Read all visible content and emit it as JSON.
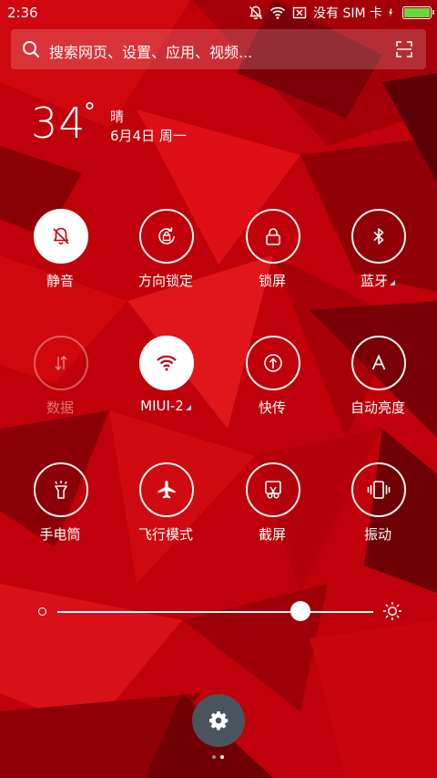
{
  "status_bar": {
    "time": "2:36",
    "carrier": "没有 SIM 卡",
    "icons": [
      "bell-off-icon",
      "wifi-icon",
      "sim-x-icon",
      "charging-icon",
      "battery-icon"
    ],
    "battery_color": "#6bd83a"
  },
  "search": {
    "placeholder": "搜索网页、设置、应用、视频...",
    "icons": [
      "search-icon",
      "scan-icon"
    ]
  },
  "weather": {
    "temperature": "34",
    "degree_symbol": "°",
    "condition": "晴",
    "date": "6月4日 周一"
  },
  "toggles": [
    {
      "label": "静音",
      "state": "on",
      "icon": "bell-off-icon"
    },
    {
      "label": "方向锁定",
      "state": "off",
      "icon": "rotation-lock-icon"
    },
    {
      "label": "锁屏",
      "state": "off",
      "icon": "lock-icon"
    },
    {
      "label": "蓝牙",
      "state": "off",
      "icon": "bluetooth-icon",
      "has_detail": true
    },
    {
      "label": "数据",
      "state": "disabled",
      "icon": "mobile-data-icon"
    },
    {
      "label": "MIUI-2",
      "state": "on",
      "icon": "wifi-icon",
      "has_detail": true
    },
    {
      "label": "快传",
      "state": "off",
      "icon": "quick-transfer-icon"
    },
    {
      "label": "自动亮度",
      "state": "off",
      "icon": "auto-brightness-icon"
    },
    {
      "label": "手电筒",
      "state": "off",
      "icon": "flashlight-icon"
    },
    {
      "label": "飞行模式",
      "state": "off",
      "icon": "airplane-icon"
    },
    {
      "label": "截屏",
      "state": "off",
      "icon": "screenshot-icon"
    },
    {
      "label": "振动",
      "state": "off",
      "icon": "vibrate-icon"
    }
  ],
  "brightness": {
    "level": 0.77,
    "icons": [
      "brightness-low-icon",
      "brightness-high-icon"
    ]
  },
  "settings_icon": "gear-icon",
  "pager": {
    "count": 2,
    "active": 1
  },
  "colors": {
    "background": "#b80006",
    "accent": "#7fd6ff",
    "settings_button": "#4a545e"
  }
}
